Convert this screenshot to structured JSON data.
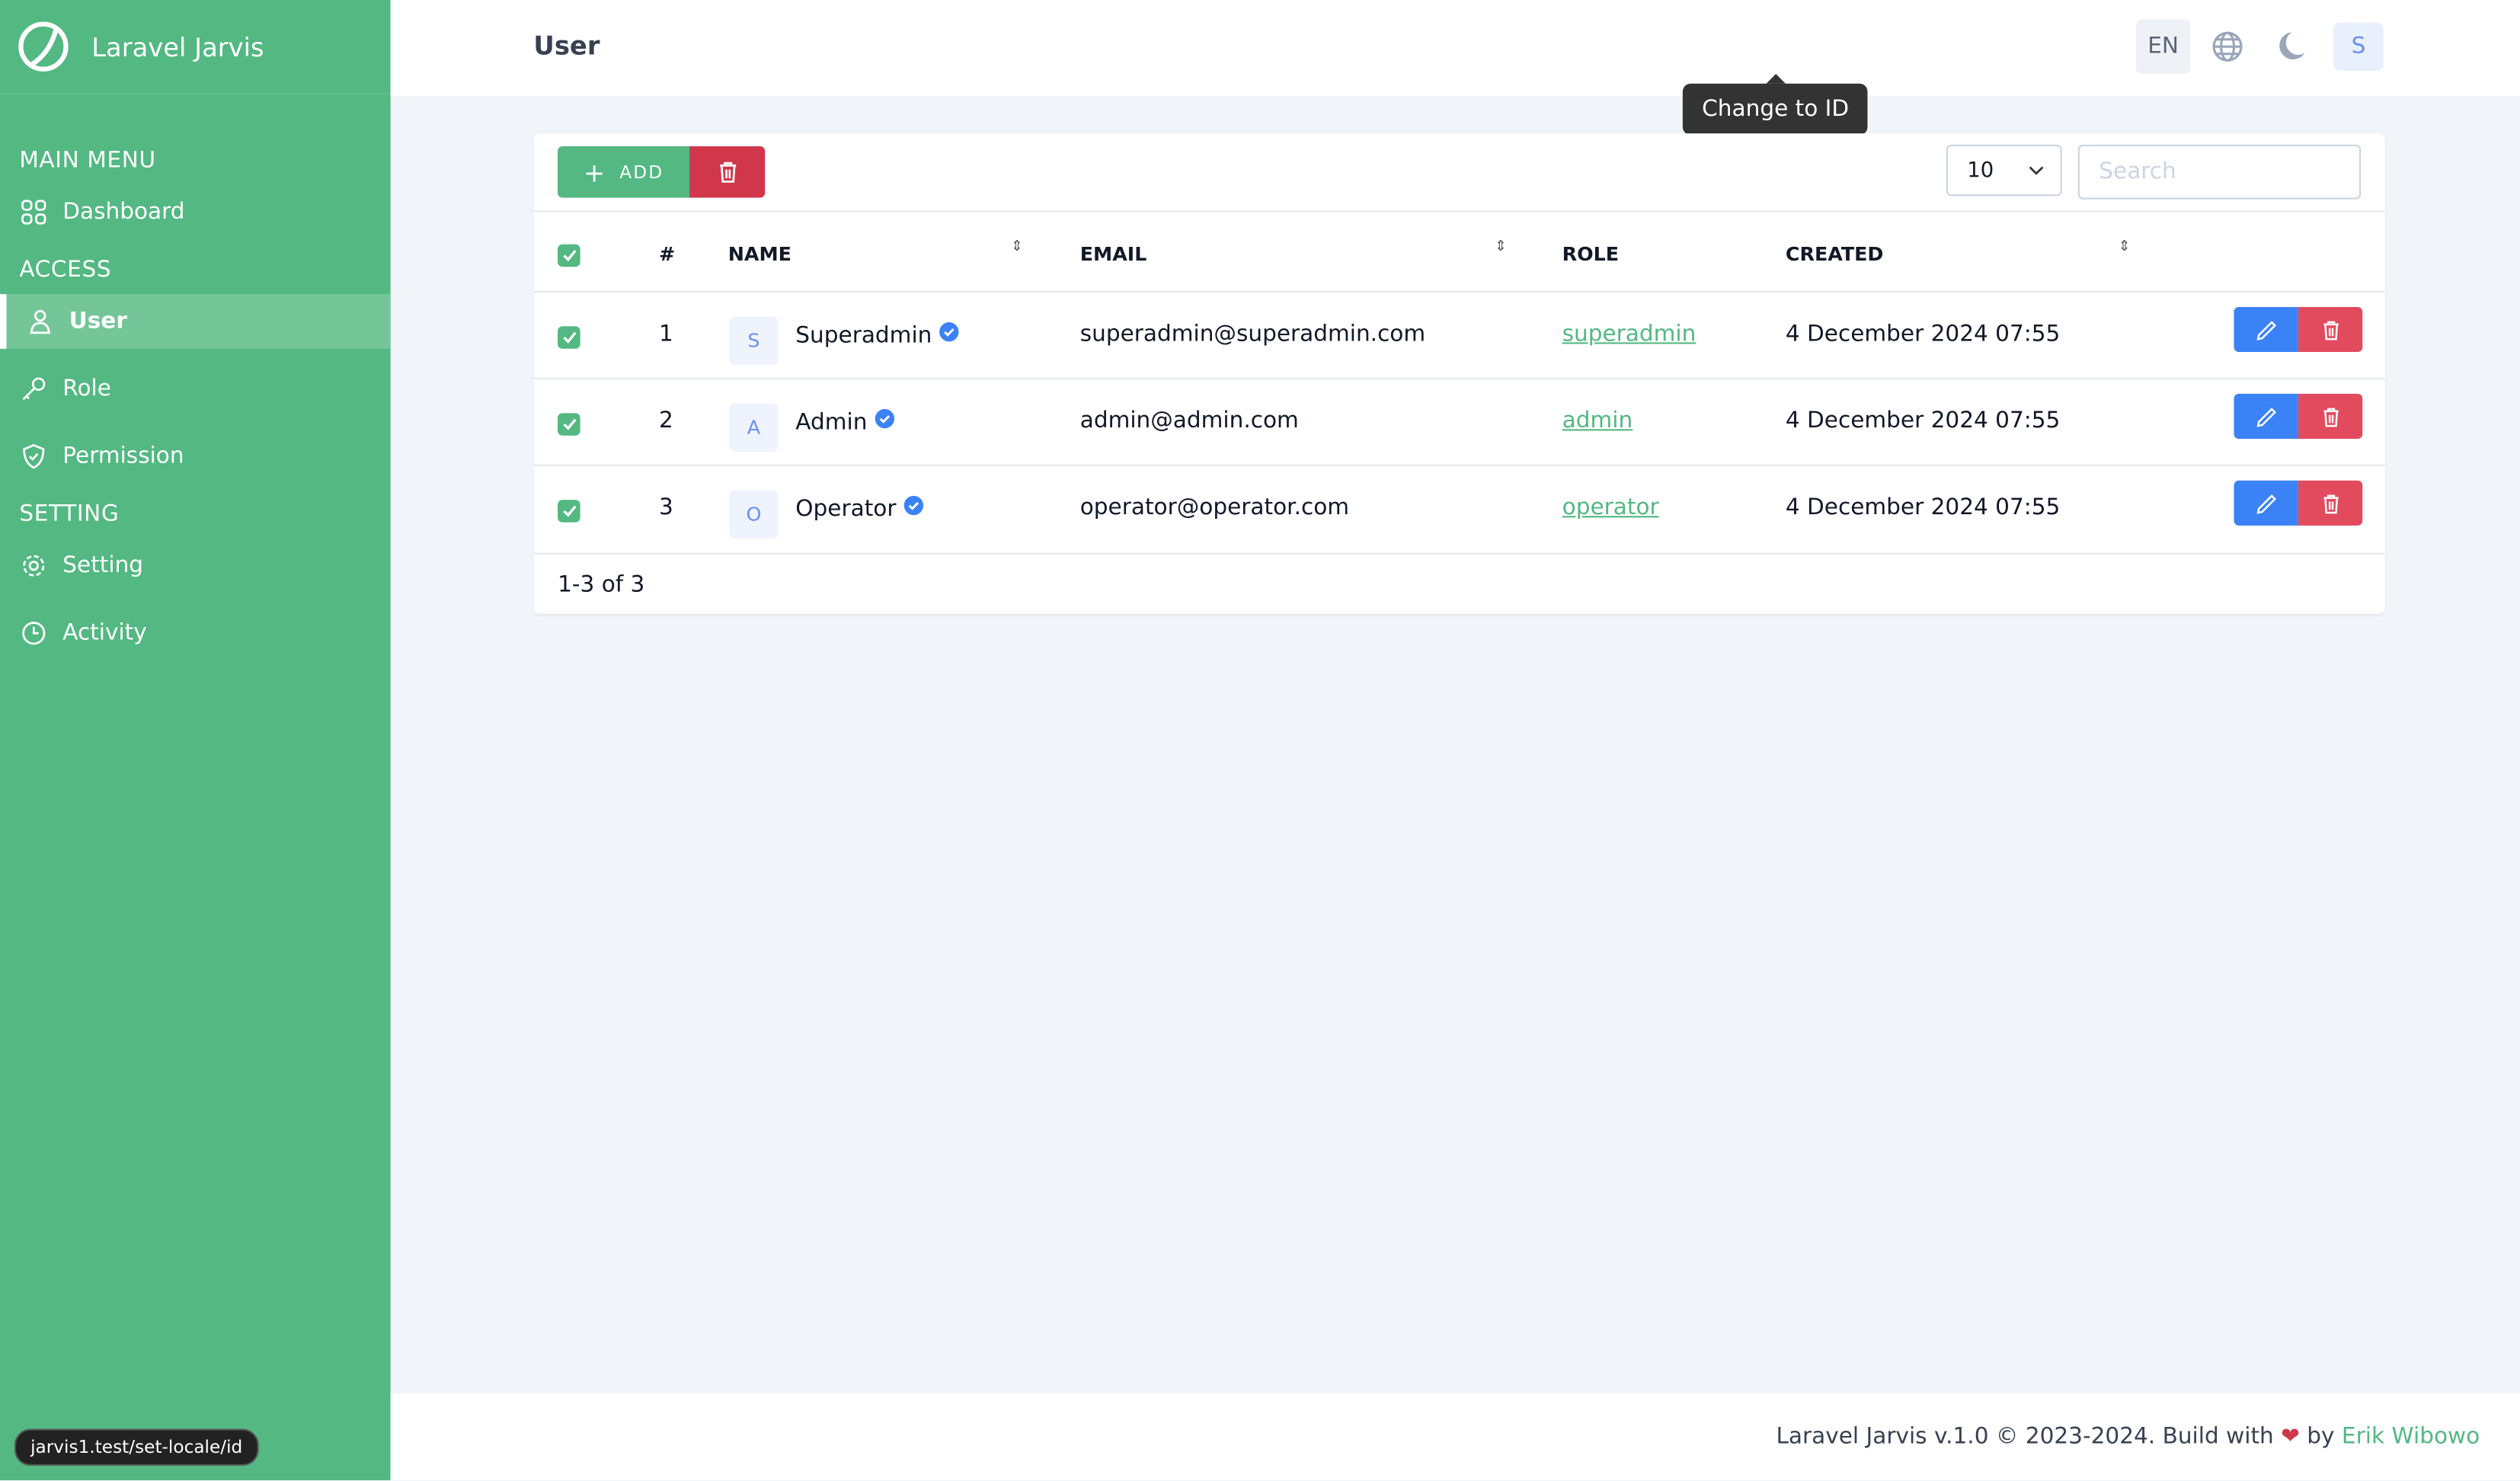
{
  "app": {
    "name": "Laravel Jarvis"
  },
  "sidebar": {
    "sections": [
      {
        "label": "MAIN MENU",
        "items": [
          {
            "label": "Dashboard",
            "icon": "grid-icon"
          }
        ]
      },
      {
        "label": "ACCESS",
        "items": [
          {
            "label": "User",
            "icon": "user-icon",
            "active": true
          },
          {
            "label": "Role",
            "icon": "key-icon"
          },
          {
            "label": "Permission",
            "icon": "shield-icon"
          }
        ]
      },
      {
        "label": "SETTING",
        "items": [
          {
            "label": "Setting",
            "icon": "gear-icon"
          },
          {
            "label": "Activity",
            "icon": "clock-icon"
          }
        ]
      }
    ]
  },
  "header": {
    "title": "User",
    "locale": "EN",
    "tooltip": "Change to ID",
    "avatar": "S"
  },
  "toolbar": {
    "add_label": "ADD",
    "per_page": "10",
    "search_placeholder": "Search"
  },
  "table": {
    "columns": [
      "#",
      "NAME",
      "EMAIL",
      "ROLE",
      "CREATED"
    ],
    "rows": [
      {
        "no": "1",
        "initial": "S",
        "name": "Superadmin",
        "email": "superadmin@superadmin.com",
        "role": "superadmin",
        "created": "4 December 2024 07:55"
      },
      {
        "no": "2",
        "initial": "A",
        "name": "Admin",
        "email": "admin@admin.com",
        "role": "admin",
        "created": "4 December 2024 07:55"
      },
      {
        "no": "3",
        "initial": "O",
        "name": "Operator",
        "email": "operator@operator.com",
        "role": "operator",
        "created": "4 December 2024 07:55"
      }
    ],
    "pagination": "1-3 of 3"
  },
  "footer": {
    "text": "Laravel Jarvis v.1.0 © 2023-2024. Build with",
    "by": "by",
    "author": "Erik Wibowo"
  },
  "status_url": "jarvis1.test/set-locale/id",
  "colors": {
    "brand": "#53b882",
    "danger": "#d0374b",
    "edit": "#3b82f6"
  }
}
